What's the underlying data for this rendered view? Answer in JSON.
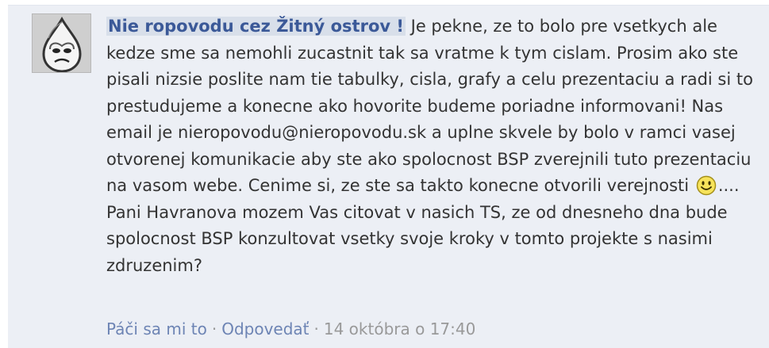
{
  "comment": {
    "author": "Nie ropovodu cez Žitný ostrov !",
    "avatar": {
      "icon": "profile-picture-drop-face"
    },
    "text_part1": "Je pekne, ze to bolo pre vsetkych ale kedze sme sa nemohli zucastnit tak sa vratme k tym cislam. Prosim ako ste pisali nizsie poslite nam tie tabulky, cisla, grafy a celu prezentaciu a radi si to prestudujeme a konecne ako hovorite budeme poriadne informovani! Nas email je nieropovodu@nieropovodu.sk a uplne skvele by bolo v ramci vasej otvorenej komunikacie aby ste ako spolocnost BSP zverejnili tuto prezentaciu na vasom webe. Cenime si, ze ste sa takto konecne otvorili verejnosti",
    "emoticon": "smiley-icon",
    "text_part2": ".... Pani Havranova mozem Vas citovat v nasich TS, ze od dnesneho dna bude spolocnost BSP konzultovat vsetky svoje kroky v tomto projekte s nasimi zdruzenim?",
    "actions": {
      "like_label": "Páči sa mi to",
      "reply_label": "Odpovedať",
      "separator": "·",
      "timestamp": "14 októbra o 17:40"
    }
  },
  "colors": {
    "comment_background": "#eceff5",
    "link": "#3b5998",
    "meta_link": "#6d84b4",
    "timestamp": "#999999",
    "author_highlight": "#d8dfea"
  }
}
